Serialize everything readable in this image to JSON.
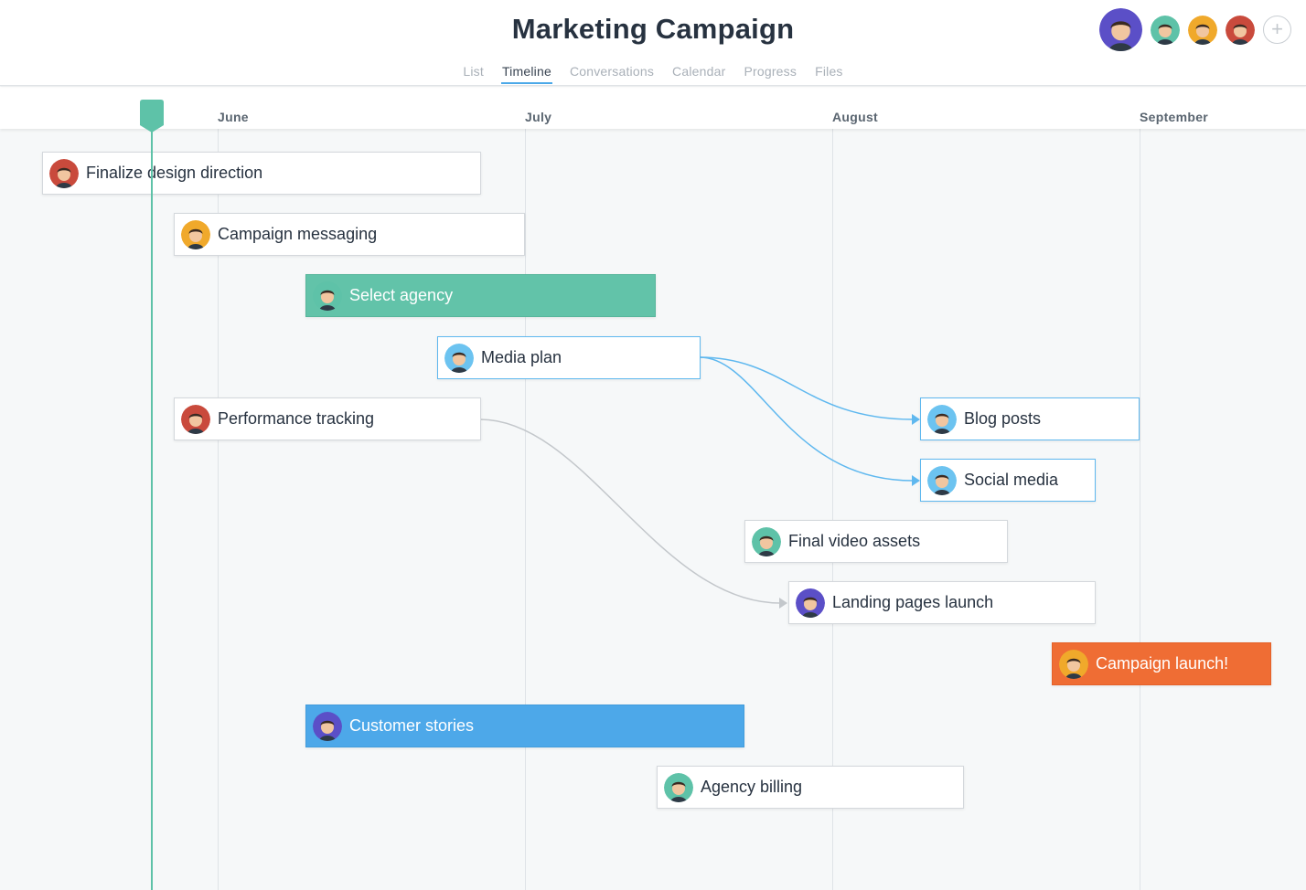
{
  "project": {
    "title": "Marketing Campaign",
    "tabs": [
      {
        "label": "List",
        "active": false
      },
      {
        "label": "Timeline",
        "active": true
      },
      {
        "label": "Conversations",
        "active": false
      },
      {
        "label": "Calendar",
        "active": false
      },
      {
        "label": "Progress",
        "active": false
      },
      {
        "label": "Files",
        "active": false
      }
    ],
    "add_member_icon": "plus-circle-icon"
  },
  "timeline": {
    "months": [
      "June",
      "July",
      "August",
      "September"
    ],
    "tasks": [
      {
        "name": "Finalize design direction",
        "style": "default",
        "assignee_color": "#c94a3c"
      },
      {
        "name": "Campaign messaging",
        "style": "default",
        "assignee_color": "#f0a92b"
      },
      {
        "name": "Select agency",
        "style": "green",
        "assignee_color": "#5ec2a8"
      },
      {
        "name": "Media plan",
        "style": "linked",
        "assignee_color": "#6cc3f0"
      },
      {
        "name": "Performance tracking",
        "style": "default",
        "assignee_color": "#c94a3c"
      },
      {
        "name": "Blog posts",
        "style": "linked",
        "assignee_color": "#6cc3f0"
      },
      {
        "name": "Social media",
        "style": "linked",
        "assignee_color": "#6cc3f0"
      },
      {
        "name": "Final video assets",
        "style": "default",
        "assignee_color": "#5ec2a8"
      },
      {
        "name": "Landing pages launch",
        "style": "default",
        "assignee_color": "#5b4fc7"
      },
      {
        "name": "Campaign launch!",
        "style": "orange",
        "assignee_color": "#f0a92b"
      },
      {
        "name": "Customer stories",
        "style": "blue",
        "assignee_color": "#5b4fc7"
      },
      {
        "name": "Agency billing",
        "style": "default",
        "assignee_color": "#5ec2a8"
      }
    ],
    "dependencies": [
      {
        "from": "Media plan",
        "to": "Blog posts"
      },
      {
        "from": "Media plan",
        "to": "Social media"
      },
      {
        "from": "Performance tracking",
        "to": "Landing pages launch"
      }
    ]
  },
  "colors": {
    "accent": "#4ba8e8",
    "today": "#5ec2a8",
    "green_task": "#62c3a9",
    "blue_task": "#4da8e9",
    "orange_task": "#ef6d34",
    "dependency_blue": "#5fb8ef",
    "dependency_gray": "#c3c7cb"
  }
}
